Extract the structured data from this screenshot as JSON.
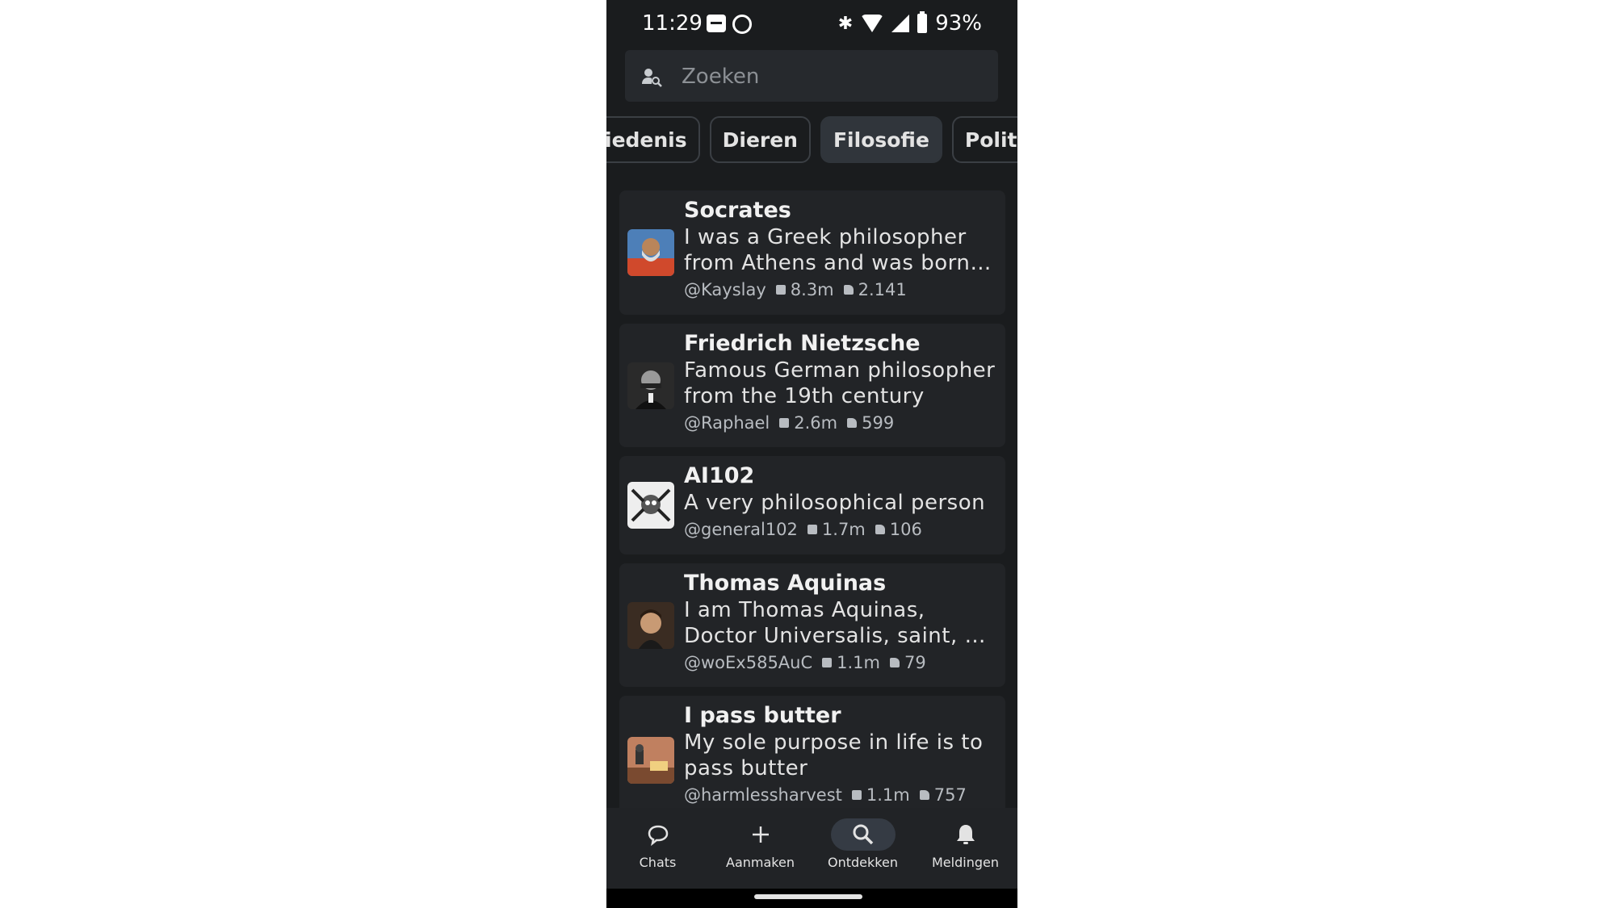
{
  "status_bar": {
    "time": "11:29",
    "battery": "93%"
  },
  "search": {
    "placeholder": "Zoeken"
  },
  "categories": [
    {
      "label": "iedenis",
      "active": false
    },
    {
      "label": "Dieren",
      "active": false
    },
    {
      "label": "Filosofie",
      "active": true
    },
    {
      "label": "Politiek",
      "active": false
    }
  ],
  "characters": [
    {
      "name": "Socrates",
      "desc1": "I was a Greek philosopher",
      "desc2": "from Athens and was born in ...",
      "creator": "@Kayslay",
      "chats": "8.3m",
      "likes": "2.141"
    },
    {
      "name": "Friedrich Nietzsche",
      "desc1": "Famous German philosopher",
      "desc2": "from the 19th century",
      "creator": "@Raphael",
      "chats": "2.6m",
      "likes": "599"
    },
    {
      "name": "AI102",
      "desc1": "A very philosophical person",
      "desc2": "",
      "creator": "@general102",
      "chats": "1.7m",
      "likes": "106"
    },
    {
      "name": "Thomas Aquinas",
      "desc1": "I am Thomas Aquinas,",
      "desc2": "Doctor Universalis, saint, and ...",
      "creator": "@woEx585AuC",
      "chats": "1.1m",
      "likes": "79"
    },
    {
      "name": "I pass butter",
      "desc1": "My sole purpose in life is to",
      "desc2": "pass butter",
      "creator": "@harmlessharvest",
      "chats": "1.1m",
      "likes": "757"
    }
  ],
  "nav": [
    {
      "label": "Chats",
      "icon": "chat-bubble-icon",
      "active": false
    },
    {
      "label": "Aanmaken",
      "icon": "plus-icon",
      "active": false
    },
    {
      "label": "Ontdekken",
      "icon": "search-icon",
      "active": true
    },
    {
      "label": "Meldingen",
      "icon": "bell-icon",
      "active": false
    }
  ]
}
